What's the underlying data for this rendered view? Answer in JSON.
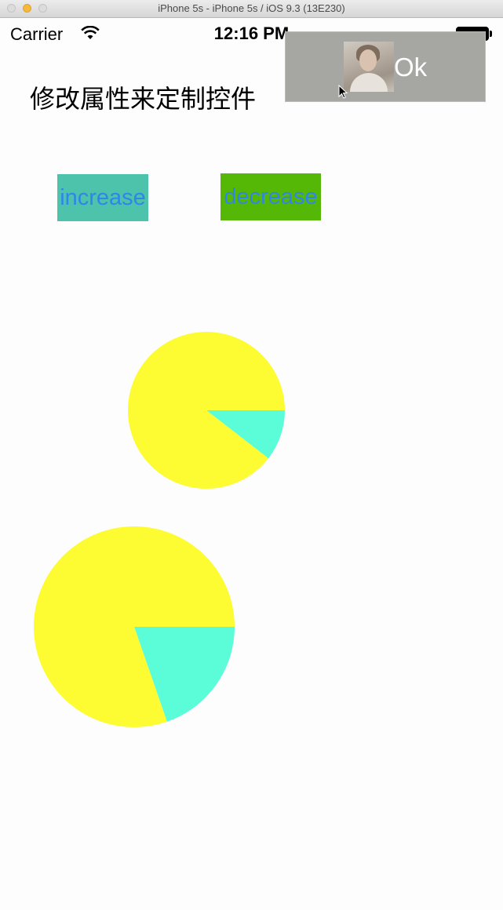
{
  "window": {
    "title": "iPhone 5s - iPhone 5s / iOS 9.3 (13E230)"
  },
  "status_bar": {
    "carrier": "Carrier",
    "time": "12:16 PM"
  },
  "banner": {
    "label": "Ok"
  },
  "page": {
    "title": "修改属性来定制控件"
  },
  "buttons": {
    "increase": "increase",
    "decrease": "decrease"
  },
  "colors": {
    "pie_main": "#fdfc33",
    "pie_slice": "#5bfdd9",
    "increase_bg": "#4ec3ab",
    "decrease_bg": "#55b806",
    "button_text": "#2f86e6"
  },
  "chart_data": [
    {
      "type": "pie",
      "labels": [
        "",
        ""
      ],
      "values": [
        0.105,
        0.895
      ]
    },
    {
      "type": "pie",
      "labels": [
        "",
        ""
      ],
      "values": [
        0.197,
        0.803
      ]
    }
  ]
}
